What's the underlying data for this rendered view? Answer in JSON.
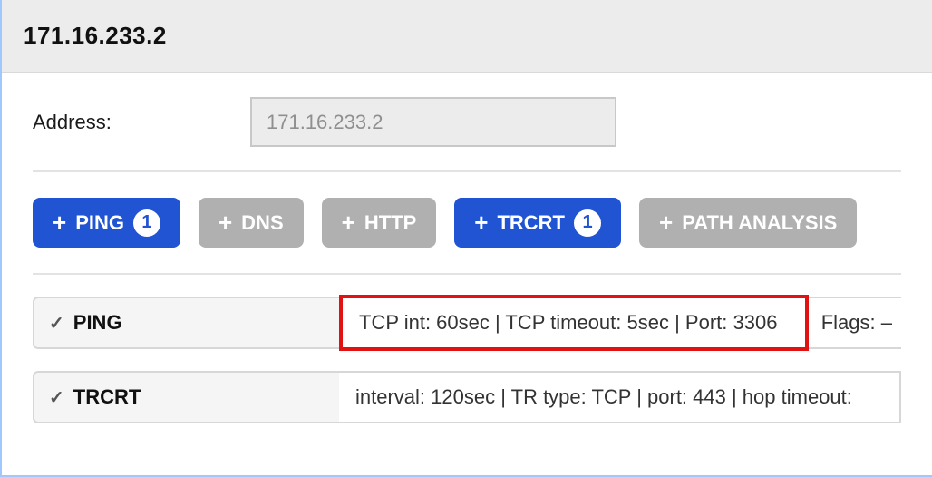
{
  "header": {
    "title": "171.16.233.2"
  },
  "form": {
    "address_label": "Address:",
    "address_value": "171.16.233.2"
  },
  "buttons": {
    "ping": {
      "label": "PING",
      "count": "1"
    },
    "dns": {
      "label": "DNS"
    },
    "http": {
      "label": "HTTP"
    },
    "trcrt": {
      "label": "TRCRT",
      "count": "1"
    },
    "path": {
      "label": "PATH ANALYSIS"
    }
  },
  "entries": {
    "ping": {
      "name": "PING",
      "details": "TCP int: 60sec | TCP timeout: 5sec | Port: 3306",
      "flags": "Flags: –"
    },
    "trcrt": {
      "name": "TRCRT",
      "details": "interval: 120sec | TR type: TCP | port: 443 | hop timeout:"
    }
  }
}
